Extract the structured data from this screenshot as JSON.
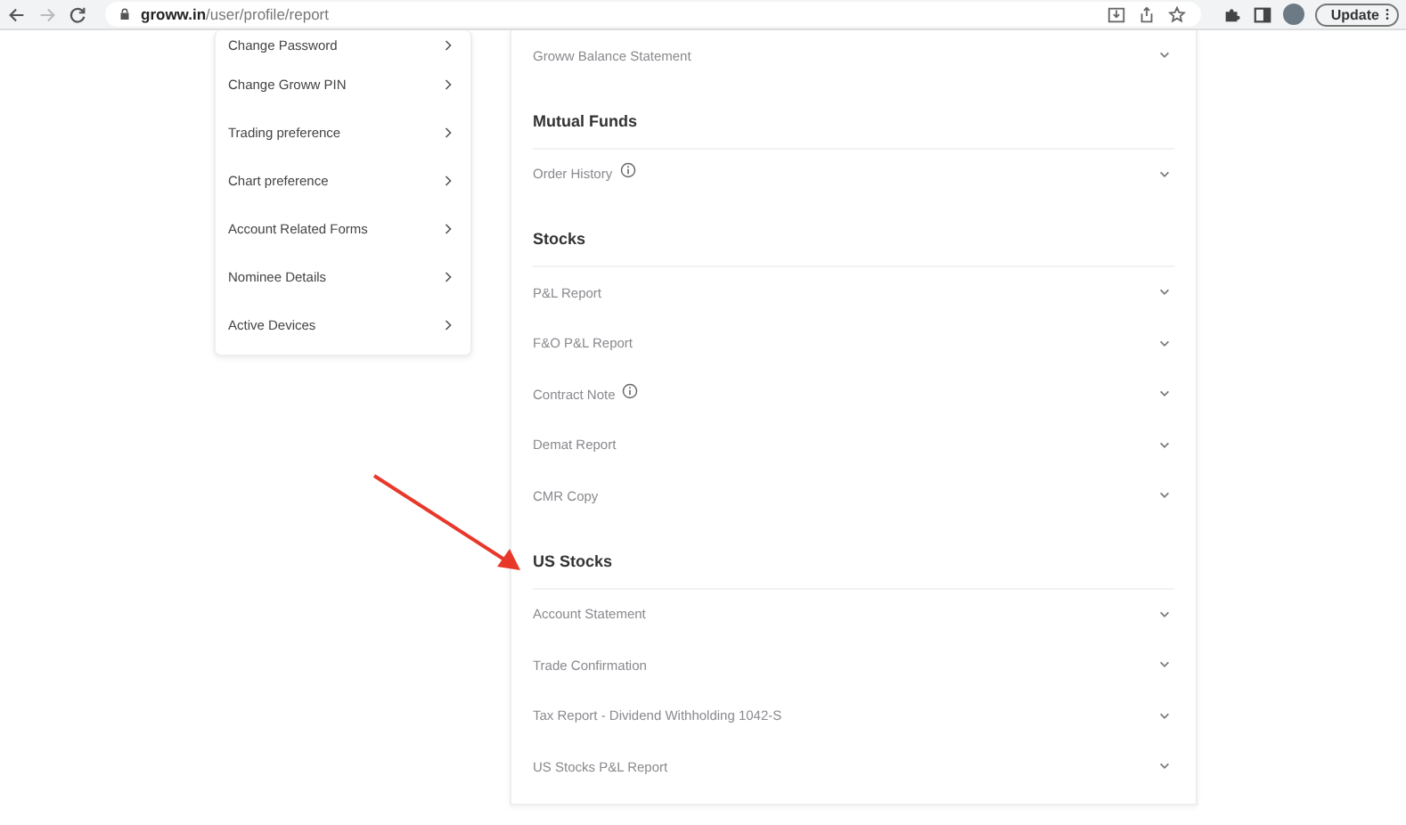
{
  "browser": {
    "url": "**groww.in**/user/profile/report",
    "update_button": "Update"
  },
  "sidebar": {
    "items": [
      {
        "label": "Change Password"
      },
      {
        "label": "Change Groww PIN"
      },
      {
        "label": "Trading preference"
      },
      {
        "label": "Chart preference"
      },
      {
        "label": "Account Related Forms"
      },
      {
        "label": "Nominee Details"
      },
      {
        "label": "Active Devices"
      }
    ]
  },
  "reports": {
    "sections": [
      {
        "items": [
          {
            "label": "Groww Balance Statement",
            "info": false
          }
        ]
      },
      {
        "heading": "Mutual Funds",
        "items": [
          {
            "label": "Order History",
            "info": true
          }
        ]
      },
      {
        "heading": "Stocks",
        "items": [
          {
            "label": "P&L Report",
            "info": false
          },
          {
            "label": "F&O P&L Report",
            "info": false
          },
          {
            "label": "Contract Note",
            "info": true
          },
          {
            "label": "Demat Report",
            "info": false
          },
          {
            "label": "CMR Copy",
            "info": false
          }
        ]
      },
      {
        "heading": "US Stocks",
        "items": [
          {
            "label": "Account Statement",
            "info": false
          },
          {
            "label": "Trade Confirmation",
            "info": false
          },
          {
            "label": "Tax Report - Dividend Withholding 1042-S",
            "info": false
          },
          {
            "label": "US Stocks P&L Report",
            "info": false
          }
        ]
      }
    ]
  }
}
